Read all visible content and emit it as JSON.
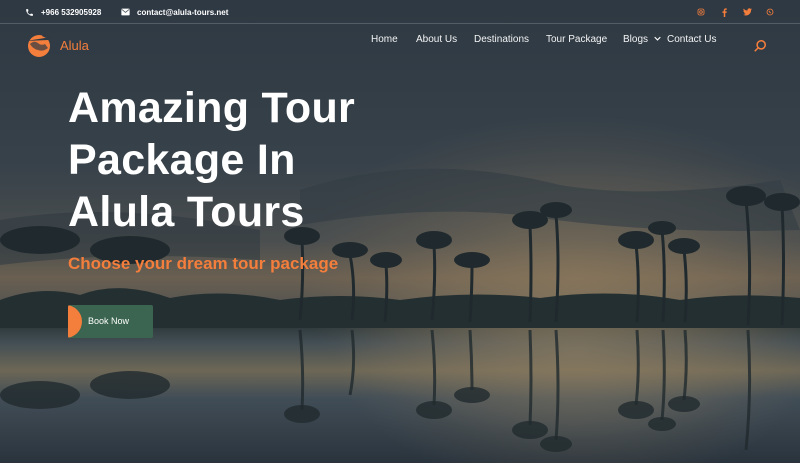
{
  "topbar": {
    "phone": "+966 532905928",
    "email": "contact@alula-tours.net",
    "socials": [
      "instagram-icon",
      "facebook-icon",
      "twitter-icon",
      "whatsapp-icon"
    ]
  },
  "brand": {
    "name": "Alula"
  },
  "nav": {
    "home": "Home",
    "about": "About Us",
    "destinations": "Destinations",
    "tour_package": "Tour Package",
    "blogs": "Blogs",
    "contact": "Contact Us"
  },
  "hero": {
    "title_line1": "Amazing Tour",
    "title_line2": "Package In",
    "title_line3": "Alula Tours",
    "subtitle": "Choose your dream tour package",
    "cta": "Book Now"
  },
  "colors": {
    "accent": "#f47e3c",
    "button": "#3b6550",
    "overlay": "#2f3a44"
  }
}
